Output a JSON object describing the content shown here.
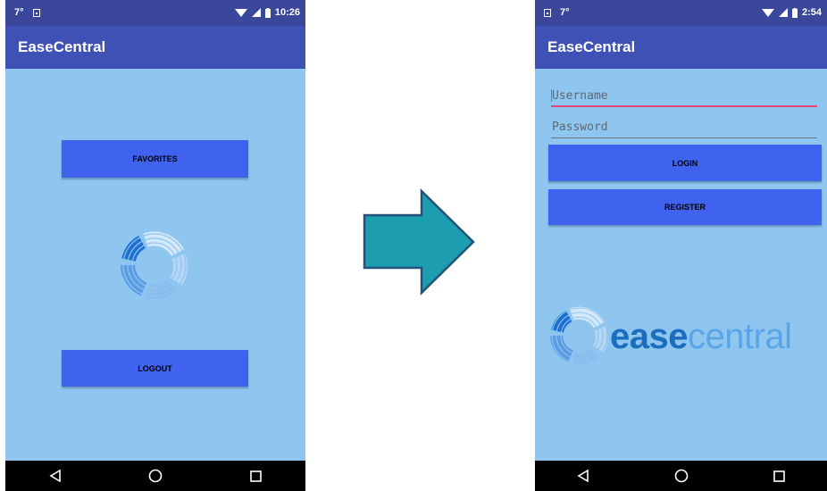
{
  "colors": {
    "status_bar": "#3a479a",
    "app_bar": "#3f51b5",
    "screen_bg": "#8ec6f0",
    "button": "#3f63ee",
    "arrow": "#1c9eb0",
    "logo_dark": "#1b6dbd",
    "logo_light": "#5aa5e8"
  },
  "left_screen": {
    "status": {
      "temp": "7°",
      "time": "10:26"
    },
    "app_title": "EaseCentral",
    "buttons": {
      "favorites": "FAVORITES",
      "logout": "LOGOUT"
    },
    "loading_icon": "spinner-logo-icon"
  },
  "transition": {
    "icon": "right-arrow-icon"
  },
  "right_screen": {
    "status": {
      "temp": "7°",
      "time": "2:54"
    },
    "app_title": "EaseCentral",
    "username": {
      "value": "",
      "placeholder": "Username"
    },
    "password": {
      "value": "",
      "placeholder": "Password"
    },
    "buttons": {
      "login": "LOGIN",
      "register": "REGISTER"
    },
    "logo": {
      "part1": "ease",
      "part2": "central"
    }
  },
  "nav_icons": [
    "back-icon",
    "home-icon",
    "recents-icon"
  ]
}
